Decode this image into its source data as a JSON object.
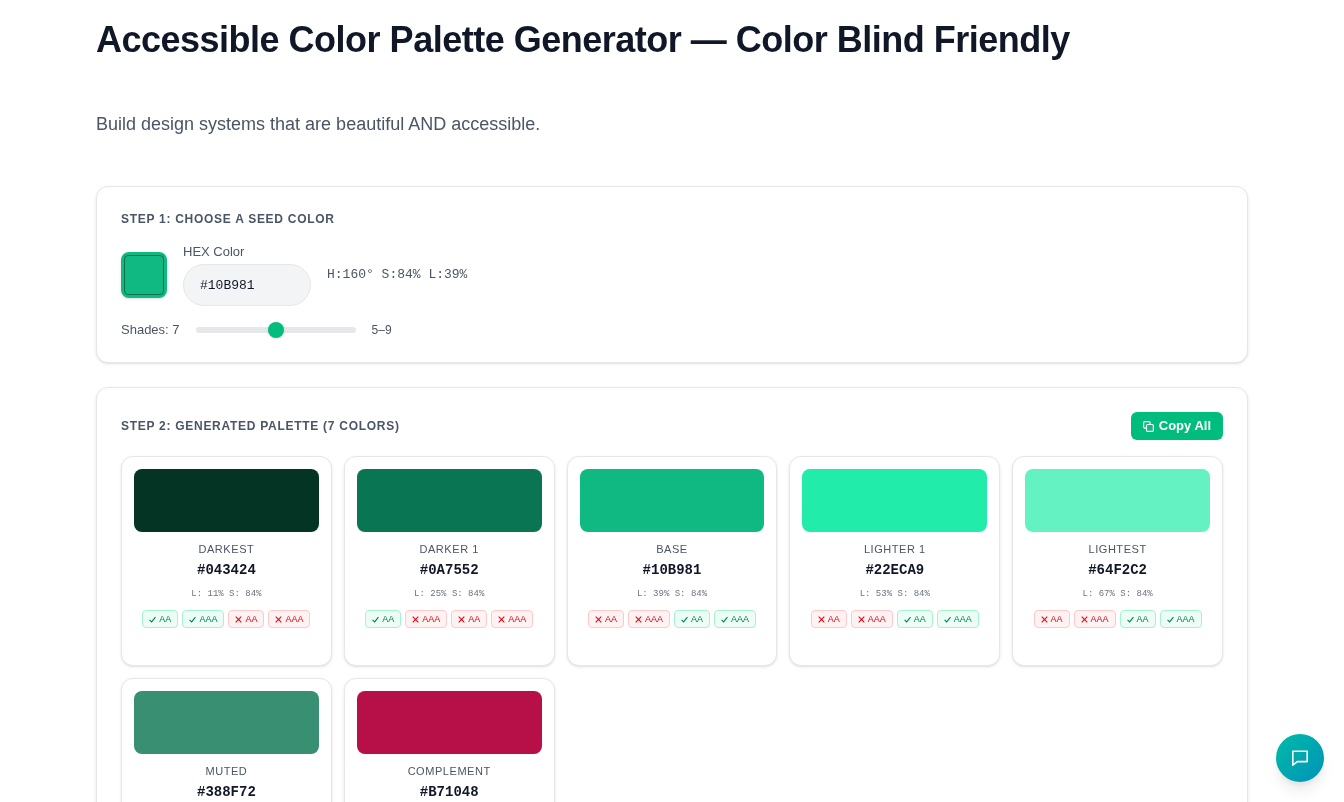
{
  "title": "Accessible Color Palette Generator — Color Blind Friendly",
  "subtitle": "Build design systems that are beautiful AND accessible.",
  "step1": {
    "heading": "STEP 1: CHOOSE A SEED COLOR",
    "seed": {
      "color": "#10b981"
    },
    "hex_label": "HEX Color",
    "hex_value": "#10B981",
    "hsl": "H:160° S:84% L:39%",
    "shades_label": "Shades: 7",
    "shades_slider": {
      "level": 0.5
    },
    "range": "5–9"
  },
  "step2": {
    "heading": "STEP 2: GENERATED PALETTE (7 COLORS)",
    "copy_button": "Copy All",
    "colors": [
      {
        "name": "DARKEST",
        "hex": "#043424",
        "color": "#043424",
        "stats": "L: 11% S: 84%",
        "badges": [
          {
            "label": "AA",
            "pass": true
          },
          {
            "label": "AAA",
            "pass": true
          },
          {
            "label": "AA",
            "pass": false
          },
          {
            "label": "AAA",
            "pass": false
          }
        ]
      },
      {
        "name": "DARKER 1",
        "hex": "#0A7552",
        "color": "#0a7552",
        "stats": "L: 25% S: 84%",
        "badges": [
          {
            "label": "AA",
            "pass": true
          },
          {
            "label": "AAA",
            "pass": false
          },
          {
            "label": "AA",
            "pass": false
          },
          {
            "label": "AAA",
            "pass": false
          }
        ]
      },
      {
        "name": "BASE",
        "hex": "#10B981",
        "color": "#10b981",
        "stats": "L: 39% S: 84%",
        "badges": [
          {
            "label": "AA",
            "pass": false
          },
          {
            "label": "AAA",
            "pass": false
          },
          {
            "label": "AA",
            "pass": true
          },
          {
            "label": "AAA",
            "pass": true
          }
        ]
      },
      {
        "name": "LIGHTER 1",
        "hex": "#22ECA9",
        "color": "#22eca9",
        "stats": "L: 53% S: 84%",
        "badges": [
          {
            "label": "AA",
            "pass": false
          },
          {
            "label": "AAA",
            "pass": false
          },
          {
            "label": "AA",
            "pass": true
          },
          {
            "label": "AAA",
            "pass": true
          }
        ]
      },
      {
        "name": "LIGHTEST",
        "hex": "#64F2C2",
        "color": "#64f2c2",
        "stats": "L: 67% S: 84%",
        "badges": [
          {
            "label": "AA",
            "pass": false
          },
          {
            "label": "AAA",
            "pass": false
          },
          {
            "label": "AA",
            "pass": true
          },
          {
            "label": "AAA",
            "pass": true
          }
        ]
      },
      {
        "name": "MUTED",
        "hex": "#388F72",
        "color": "#388f72"
      },
      {
        "name": "COMPLEMENT",
        "hex": "#B71048",
        "color": "#b71048"
      }
    ]
  }
}
